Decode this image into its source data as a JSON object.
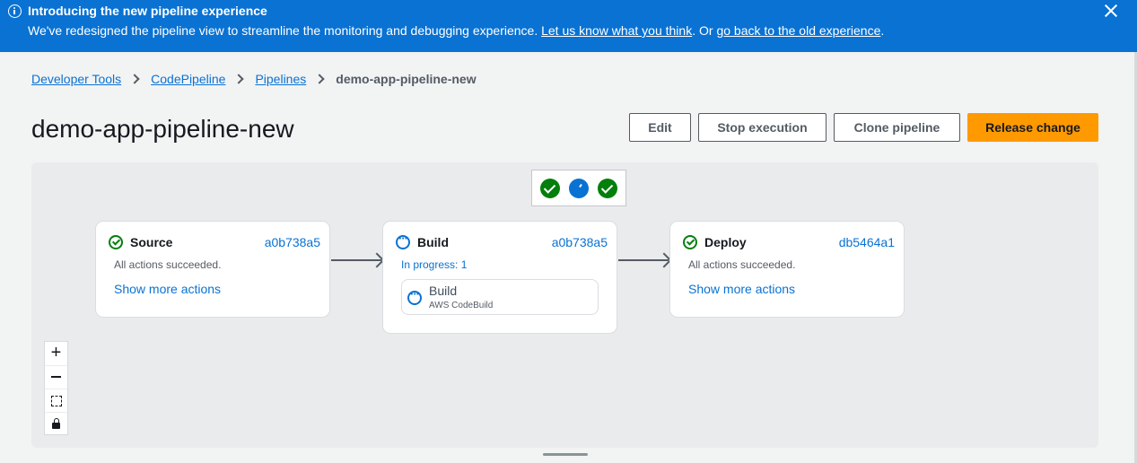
{
  "banner": {
    "title": "Introducing the new pipeline experience",
    "text_before": "We've redesigned the pipeline view to streamline the monitoring and debugging experience.",
    "feedback_link": "Let us know what you think",
    "text_middle": ". Or",
    "old_link": "go back to the old experience",
    "text_end": "."
  },
  "breadcrumb": {
    "items": [
      "Developer Tools",
      "CodePipeline",
      "Pipelines"
    ],
    "current": "demo-app-pipeline-new"
  },
  "page_title": "demo-app-pipeline-new",
  "actions": {
    "edit": "Edit",
    "stop": "Stop execution",
    "clone": "Clone pipeline",
    "release": "Release change"
  },
  "status_strip": [
    "succeeded",
    "in-progress",
    "succeeded"
  ],
  "stages": [
    {
      "name": "Source",
      "revision": "a0b738a5",
      "status": "All actions succeeded.",
      "state": "succeeded",
      "link": "Show more actions"
    },
    {
      "name": "Build",
      "revision": "a0b738a5",
      "status": "In progress: 1",
      "state": "in-progress",
      "action": {
        "name": "Build",
        "provider": "AWS CodeBuild"
      }
    },
    {
      "name": "Deploy",
      "revision": "db5464a1",
      "status": "All actions succeeded.",
      "state": "succeeded",
      "link": "Show more actions"
    }
  ],
  "zoom_controls": {
    "zoom_in": "+"
  },
  "colors": {
    "banner": "#0972d3",
    "primary": "#ff9900",
    "success": "#037f0c",
    "link": "#0972d3"
  },
  "icons": [
    "info-icon",
    "close-icon",
    "chevron-right-icon",
    "check-circle-icon",
    "in-progress-icon",
    "zoom-in-icon",
    "zoom-out-icon",
    "fit-view-icon",
    "lock-icon"
  ]
}
